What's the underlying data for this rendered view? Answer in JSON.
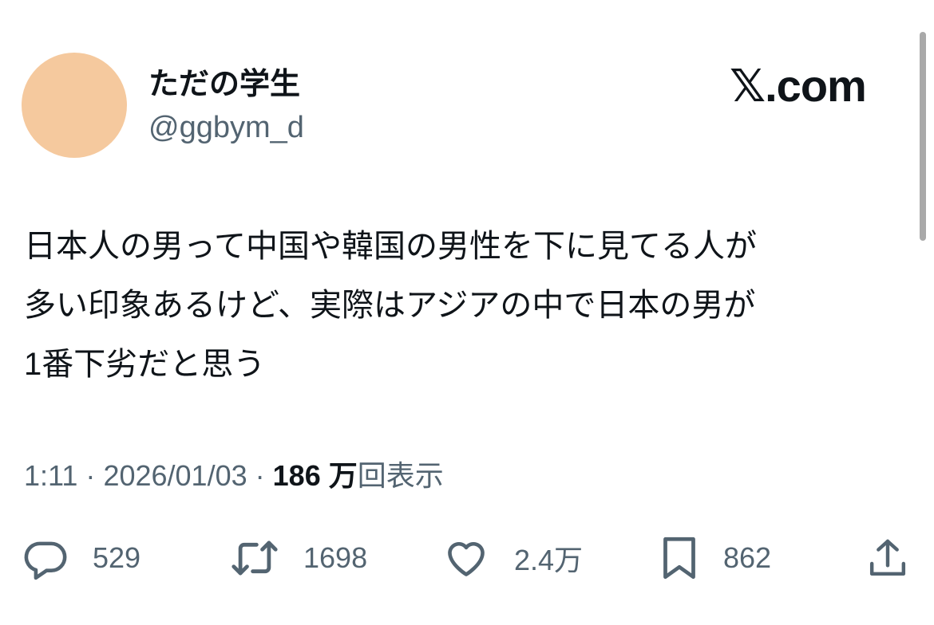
{
  "user": {
    "display_name": "ただの学生",
    "handle": "@ggbym_d",
    "avatar_color": "#f5c99e"
  },
  "brand": {
    "x_glyph": "𝕏",
    "domain": ".com"
  },
  "tweet": {
    "text": "日本人の男って中国や韓国の男性を下に見てる人が\n多い印象あるけど、実際はアジアの中で日本の男が\n1番下劣だと思う"
  },
  "meta": {
    "time": "1:11",
    "separator": "·",
    "date": "2026/01/03",
    "views_count": "186 万",
    "views_label": "回表示"
  },
  "actions": {
    "reply": {
      "icon": "reply-icon",
      "count": "529"
    },
    "retweet": {
      "icon": "retweet-icon",
      "count": "1698"
    },
    "like": {
      "icon": "heart-icon",
      "count": "2.4万"
    },
    "bookmark": {
      "icon": "bookmark-icon",
      "count": "862"
    },
    "share": {
      "icon": "share-icon"
    }
  },
  "colors": {
    "text": "#0f1419",
    "secondary": "#536471"
  }
}
